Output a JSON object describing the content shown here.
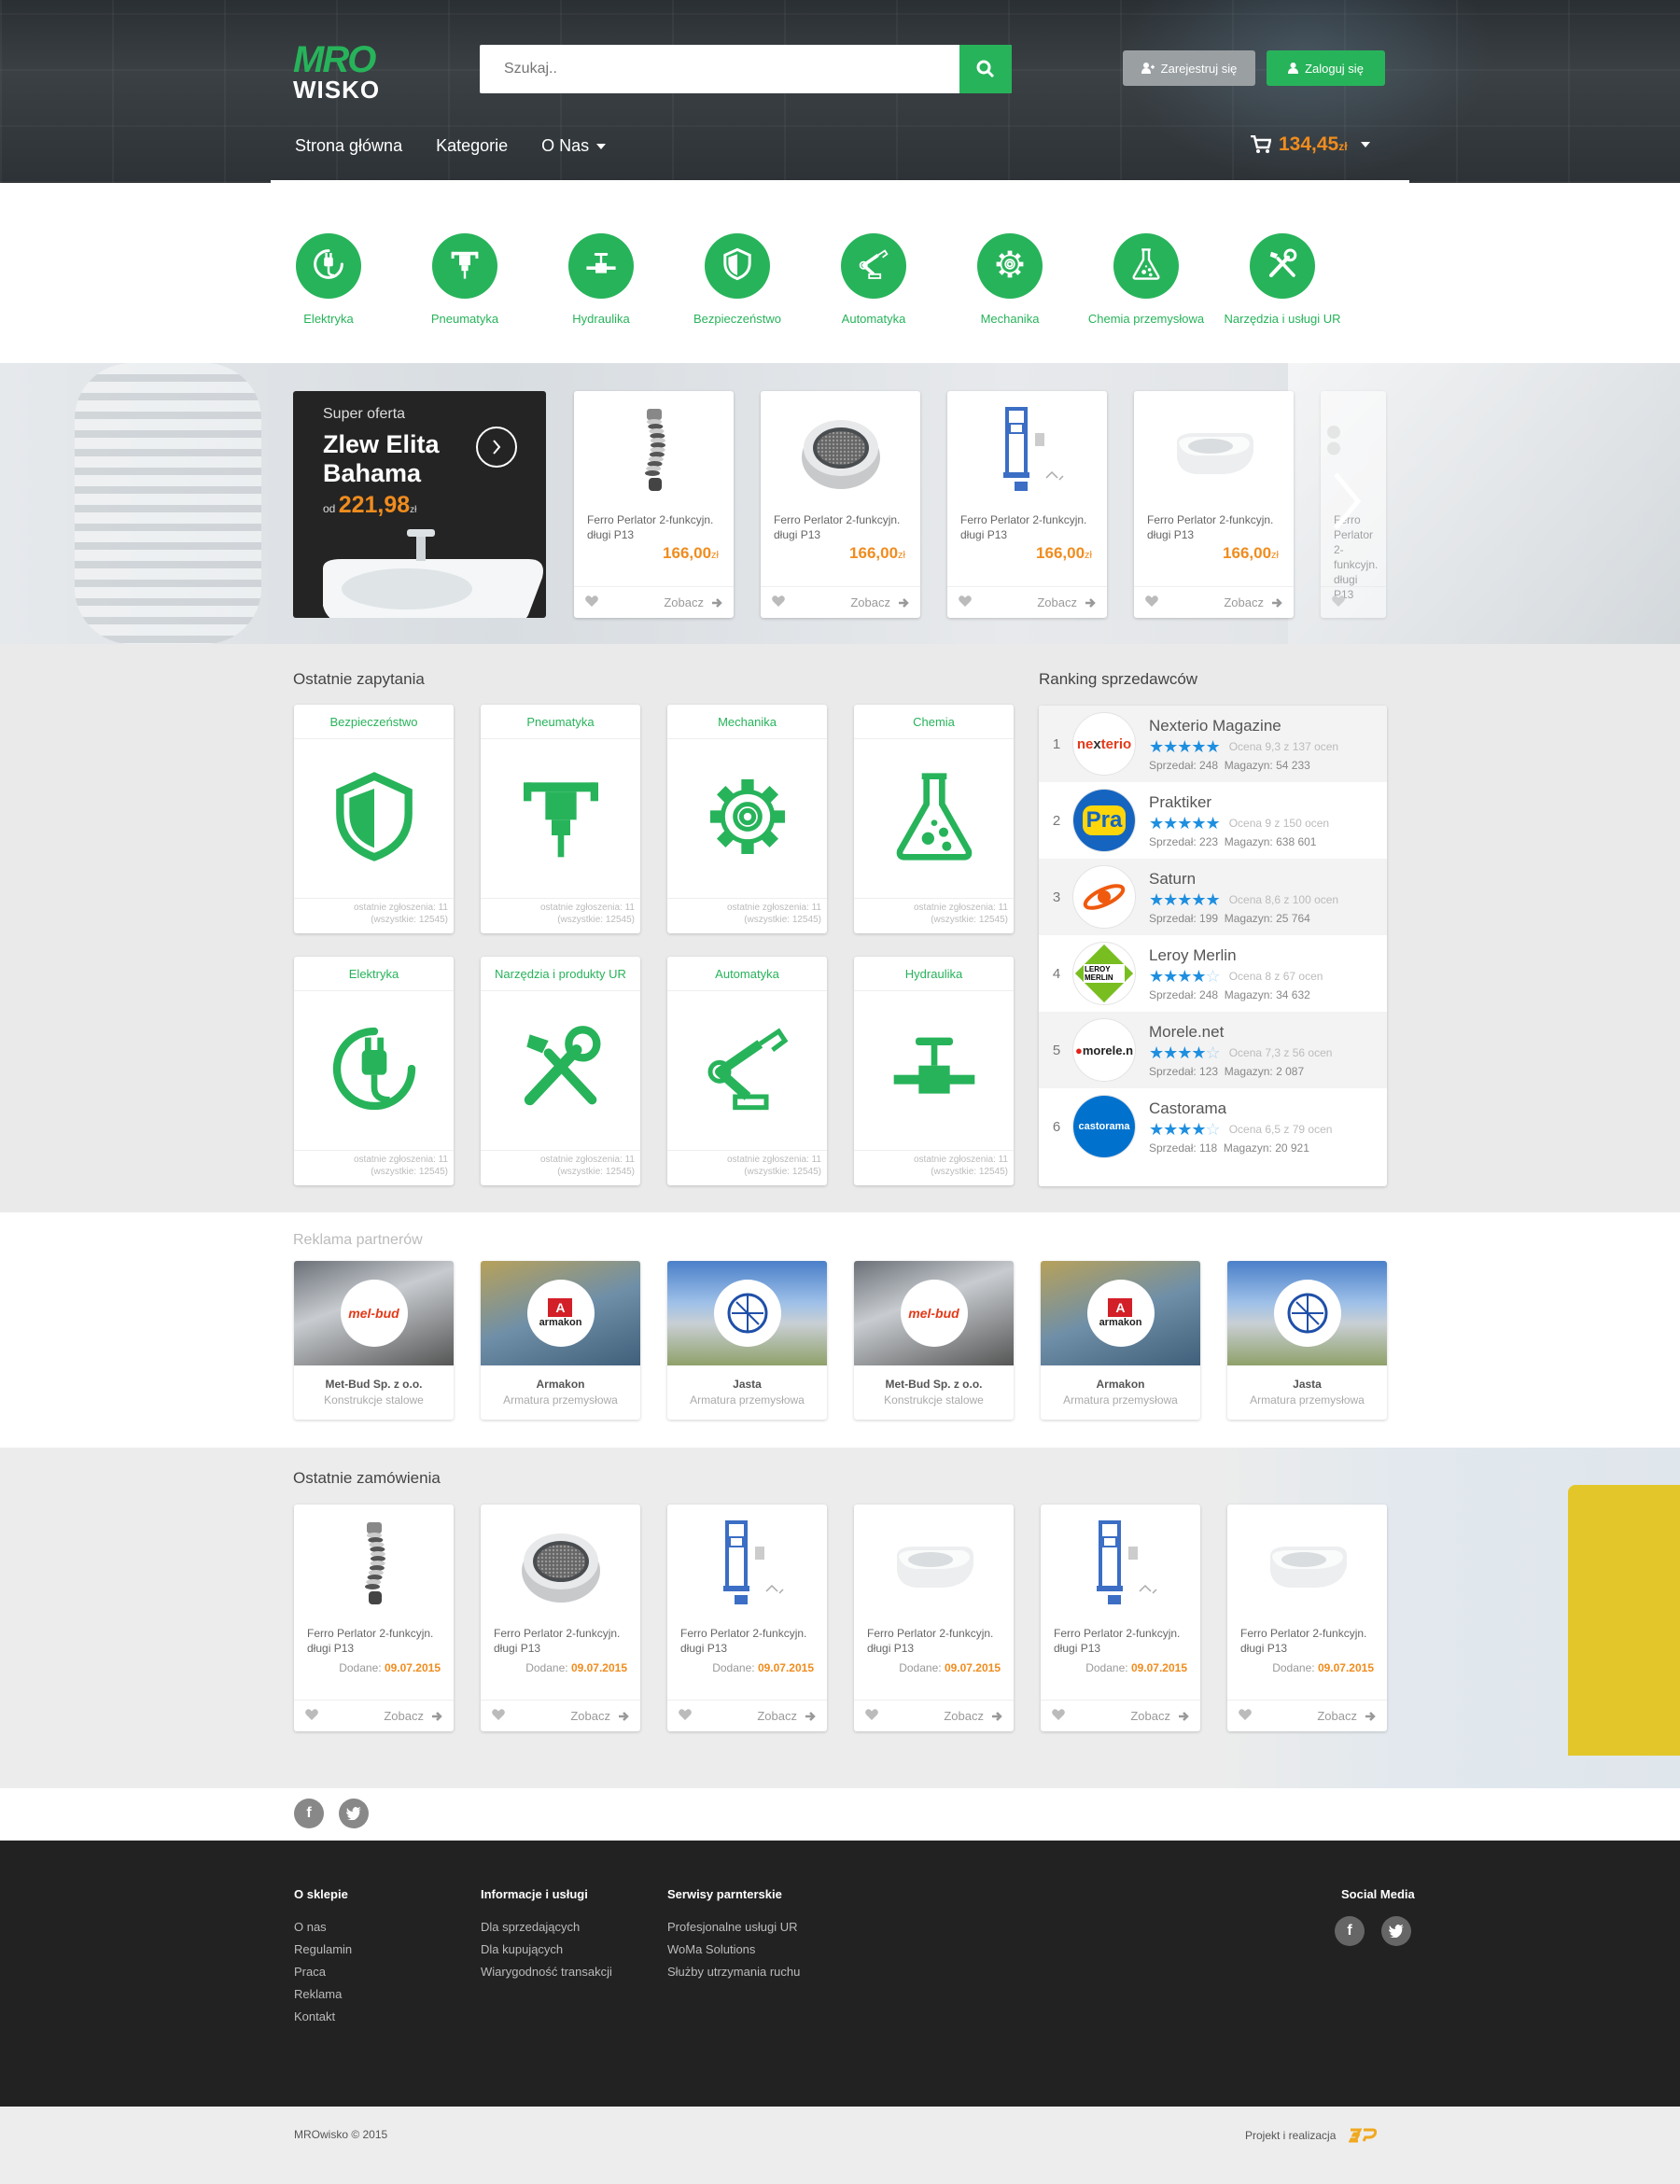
{
  "header": {
    "logo_top": "MRO",
    "logo_bottom": "WISKO",
    "search_placeholder": "Szukaj..",
    "register_label": "Zarejestruj się",
    "login_label": "Zaloguj się",
    "nav": [
      "Strona główna",
      "Kategorie",
      "O Nas"
    ],
    "cart_amount": "134,45",
    "cart_currency": "zł"
  },
  "categories": [
    {
      "label": "Elektryka",
      "icon": "plug-icon"
    },
    {
      "label": "Pneumatyka",
      "icon": "jackhammer-icon"
    },
    {
      "label": "Hydraulika",
      "icon": "valve-icon"
    },
    {
      "label": "Bezpieczeństwo",
      "icon": "shield-icon"
    },
    {
      "label": "Automatyka",
      "icon": "robot-arm-icon"
    },
    {
      "label": "Mechanika",
      "icon": "gear-icon"
    },
    {
      "label": "Chemia przemysłowa",
      "icon": "flask-icon"
    },
    {
      "label": "Narzędzia i usługi UR",
      "icon": "tools-icon"
    }
  ],
  "offer": {
    "kicker": "Super oferta",
    "title": "Zlew Elita Bahama",
    "from": "od",
    "price": "221,98",
    "currency": "zł"
  },
  "hero_products": [
    {
      "name": "Ferro Perlator 2-funkcyjn. długi P13",
      "price": "166,00",
      "currency": "zł",
      "action": "Zobacz",
      "img": "faucet-hose"
    },
    {
      "name": "Ferro Perlator 2-funkcyjn. długi P13",
      "price": "166,00",
      "currency": "zł",
      "action": "Zobacz",
      "img": "aerator"
    },
    {
      "name": "Ferro Perlator 2-funkcyjn. długi P13",
      "price": "166,00",
      "currency": "zł",
      "action": "Zobacz",
      "img": "frame"
    },
    {
      "name": "Ferro Perlator 2-funkcyjn. długi P13",
      "price": "166,00",
      "currency": "zł",
      "action": "Zobacz",
      "img": "toilet"
    },
    {
      "name": "Ferro Perlator 2-funkcyjn. długi P13",
      "price": "",
      "currency": "",
      "action": "",
      "img": "partial"
    }
  ],
  "queries": {
    "title": "Ostatnie zapytania",
    "items": [
      {
        "label": "Bezpieczeństwo",
        "icon": "shield-icon",
        "recent": "ostatnie zgłoszenia: 11",
        "all": "(wszystkie: 12545)"
      },
      {
        "label": "Pneumatyka",
        "icon": "jackhammer-icon",
        "recent": "ostatnie zgłoszenia: 11",
        "all": "(wszystkie: 12545)"
      },
      {
        "label": "Mechanika",
        "icon": "gear-icon",
        "recent": "ostatnie zgłoszenia: 11",
        "all": "(wszystkie: 12545)"
      },
      {
        "label": "Chemia",
        "icon": "flask-icon",
        "recent": "ostatnie zgłoszenia: 11",
        "all": "(wszystkie: 12545)"
      },
      {
        "label": "Elektryka",
        "icon": "plug-icon",
        "recent": "ostatnie zgłoszenia: 11",
        "all": "(wszystkie: 12545)"
      },
      {
        "label": "Narzędzia i produkty UR",
        "icon": "tools-icon",
        "recent": "ostatnie zgłoszenia: 11",
        "all": "(wszystkie: 12545)"
      },
      {
        "label": "Automatyka",
        "icon": "robot-arm-icon",
        "recent": "ostatnie zgłoszenia: 11",
        "all": "(wszystkie: 12545)"
      },
      {
        "label": "Hydraulika",
        "icon": "valve-icon",
        "recent": "ostatnie zgłoszenia: 11",
        "all": "(wszystkie: 12545)"
      }
    ]
  },
  "ranking": {
    "title": "Ranking sprzedawców",
    "items": [
      {
        "rank": "1",
        "name": "Nexterio Magazine",
        "logo": "nexterio",
        "stars": 4.5,
        "score": "Ocena 9,3 z 137 ocen",
        "sales": "Sprzedał: 248",
        "stock": "Magazyn: 54 233"
      },
      {
        "rank": "2",
        "name": "Praktiker",
        "logo": "Pra",
        "stars": 4.5,
        "score": "Ocena 9 z 150 ocen",
        "sales": "Sprzedał: 223",
        "stock": "Magazyn: 638 601"
      },
      {
        "rank": "3",
        "name": "Saturn",
        "logo": "saturn",
        "stars": 4.5,
        "score": "Ocena 8,6 z 100 ocen",
        "sales": "Sprzedał: 199",
        "stock": "Magazyn: 25 764"
      },
      {
        "rank": "4",
        "name": "Leroy Merlin",
        "logo": "LEROY MERLIN",
        "stars": 4,
        "score": "Ocena 8 z 67 ocen",
        "sales": "Sprzedał: 248",
        "stock": "Magazyn: 34 632"
      },
      {
        "rank": "5",
        "name": "Morele.net",
        "logo": "morele.n",
        "stars": 3.5,
        "score": "Ocena 7,3 z 56 ocen",
        "sales": "Sprzedał: 123",
        "stock": "Magazyn: 2 087"
      },
      {
        "rank": "6",
        "name": "Castorama",
        "logo": "castorama",
        "stars": 3.5,
        "score": "Ocena 6,5 z 79 ocen",
        "sales": "Sprzedał: 118",
        "stock": "Magazyn: 20 921"
      }
    ]
  },
  "partners": {
    "title": "Reklama partnerów",
    "items": [
      {
        "name": "Met-Bud Sp. z o.o.",
        "desc": "Konstrukcje stalowe",
        "logo": "met-bud"
      },
      {
        "name": "Armakon",
        "desc": "Armatura przemysłowa",
        "logo": "armakon"
      },
      {
        "name": "Jasta",
        "desc": "Armatura przemysłowa",
        "logo": "jasta"
      },
      {
        "name": "Met-Bud Sp. z o.o.",
        "desc": "Konstrukcje stalowe",
        "logo": "met-bud"
      },
      {
        "name": "Armakon",
        "desc": "Armatura przemysłowa",
        "logo": "armakon"
      },
      {
        "name": "Jasta",
        "desc": "Armatura przemysłowa",
        "logo": "jasta"
      }
    ]
  },
  "orders": {
    "title": "Ostatnie zamówienia",
    "items": [
      {
        "name": "Ferro Perlator 2-funkcyjn. długi P13",
        "added": "Dodane:",
        "date": "09.07.2015",
        "action": "Zobacz",
        "img": "faucet-hose"
      },
      {
        "name": "Ferro Perlator 2-funkcyjn. długi P13",
        "added": "Dodane:",
        "date": "09.07.2015",
        "action": "Zobacz",
        "img": "aerator"
      },
      {
        "name": "Ferro Perlator 2-funkcyjn. długi P13",
        "added": "Dodane:",
        "date": "09.07.2015",
        "action": "Zobacz",
        "img": "frame"
      },
      {
        "name": "Ferro Perlator 2-funkcyjn. długi P13",
        "added": "Dodane:",
        "date": "09.07.2015",
        "action": "Zobacz",
        "img": "toilet"
      },
      {
        "name": "Ferro Perlator 2-funkcyjn. długi P13",
        "added": "Dodane:",
        "date": "09.07.2015",
        "action": "Zobacz",
        "img": "frame"
      },
      {
        "name": "Ferro Perlator 2-funkcyjn. długi P13",
        "added": "Dodane:",
        "date": "09.07.2015",
        "action": "Zobacz",
        "img": "toilet"
      }
    ]
  },
  "footer": {
    "col1": {
      "title": "O sklepie",
      "items": [
        "O nas",
        "Regulamin",
        "Praca",
        "Reklama",
        "Kontakt"
      ]
    },
    "col2": {
      "title": "Informacje i usługi",
      "items": [
        "Dla sprzedających",
        "Dla kupujących",
        "Wiarygodność transakcji"
      ]
    },
    "col3": {
      "title": "Serwisy parnterskie",
      "items": [
        "Profesjonalne usługi UR",
        "WoMa Solutions",
        "Służby utrzymania ruchu"
      ]
    },
    "social_title": "Social Media",
    "copyright": "MROwisko © 2015",
    "credits": "Projekt i realizacja"
  },
  "colors": {
    "accent": "#27b35a",
    "price": "#f08c1e",
    "footer": "#222222"
  }
}
